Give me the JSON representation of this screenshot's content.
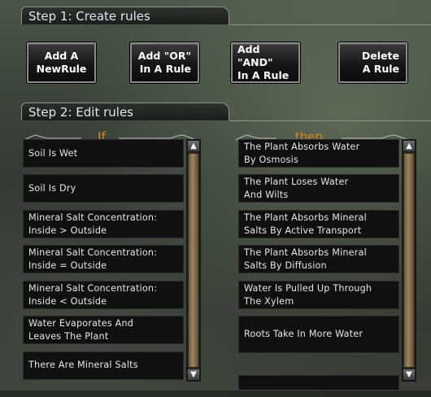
{
  "step1": {
    "label": "Step 1: Create rules"
  },
  "buttons": [
    {
      "label": "Add A\nNewRule"
    },
    {
      "label": "Add \"OR\"\nIn A Rule"
    },
    {
      "label": "Add \"AND\"\nIn A Rule"
    },
    {
      "label": "Delete\nA Rule"
    }
  ],
  "step2": {
    "label": "Step 2: Edit rules"
  },
  "if_column": {
    "title": "If",
    "items": [
      "Soil Is Wet",
      "Soil Is Dry",
      "Mineral Salt Concentration:\nInside > Outside",
      "Mineral Salt Concentration:\nInside = Outside",
      "Mineral Salt Concentration:\nInside < Outside",
      "Water Evaporates And\nLeaves The Plant",
      "There Are Mineral Salts"
    ],
    "scroll_position": 0.0
  },
  "then_column": {
    "title": "then",
    "items": [
      "The Plant Absorbs Water\nBy Osmosis",
      "The Plant Loses Water\nAnd Wilts",
      "The Plant Absorbs Mineral\nSalts By Active Transport",
      "The Plant Absorbs Mineral\nSalts By Diffusion",
      "Water Is Pulled Up Through\nThe Xylem",
      "Roots Take In More Water",
      ""
    ],
    "scroll_position": 0.0
  },
  "colors": {
    "accent": "#d8871f",
    "text": "#e6e6e6",
    "tab_text": "#dfe6ef"
  },
  "icons": {
    "scroll_up": "arrow-up-icon",
    "scroll_down": "arrow-down-icon"
  }
}
